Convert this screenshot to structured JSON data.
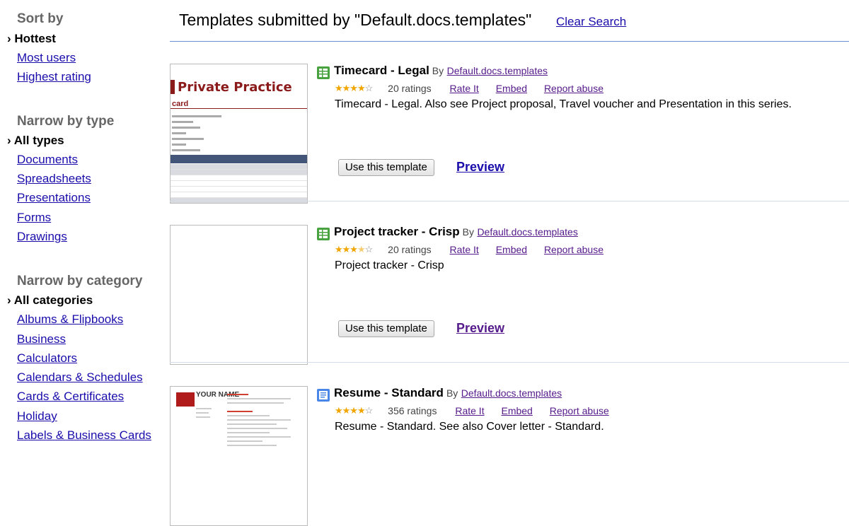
{
  "sidebar": {
    "sort_heading": "Sort by",
    "sort_selected": "› Hottest",
    "sort_links": [
      "Most users",
      "Highest rating"
    ],
    "type_heading": "Narrow by type",
    "type_selected": "› All types",
    "type_links": [
      "Documents",
      "Spreadsheets",
      "Presentations",
      "Forms",
      "Drawings"
    ],
    "category_heading": "Narrow by category",
    "category_selected": "› All categories",
    "category_links": [
      "Albums & Flipbooks",
      "Business",
      "Calculators",
      "Calendars & Schedules",
      "Cards & Certificates",
      "Holiday",
      "Labels & Business Cards"
    ]
  },
  "header": {
    "title": "Templates submitted by \"Default.docs.templates\"",
    "clear_search": "Clear Search"
  },
  "colors": {
    "link": "#1a0dab",
    "visited": "#551a8b",
    "star": "#f0a500",
    "rule": "#6b8fd6"
  },
  "results": [
    {
      "icon": "spreadsheet-icon",
      "name": "Timecard - Legal",
      "by": "By",
      "author": "Default.docs.templates",
      "rating_stars": 4,
      "ratings": "20 ratings",
      "rate_it": "Rate It",
      "embed": "Embed",
      "report": "Report abuse",
      "description": "Timecard - Legal. Also see Project proposal, Travel voucher and Presentation in this series.",
      "use_button": "Use this template",
      "preview": "Preview",
      "thumb_title": "Private Practice",
      "thumb_sub": "card"
    },
    {
      "icon": "spreadsheet-icon",
      "name": "Project tracker - Crisp",
      "by": "By",
      "author": "Default.docs.templates",
      "rating_stars": 3.5,
      "ratings": "20 ratings",
      "rate_it": "Rate It",
      "embed": "Embed",
      "report": "Report abuse",
      "description": "Project tracker - Crisp",
      "use_button": "Use this template",
      "preview": "Preview"
    },
    {
      "icon": "document-icon",
      "name": "Resume - Standard",
      "by": "By",
      "author": "Default.docs.templates",
      "rating_stars": 4,
      "ratings": "356 ratings",
      "rate_it": "Rate It",
      "embed": "Embed",
      "report": "Report abuse",
      "description": "Resume - Standard. See also Cover letter - Standard.",
      "thumb_name": "YOUR NAME"
    }
  ]
}
